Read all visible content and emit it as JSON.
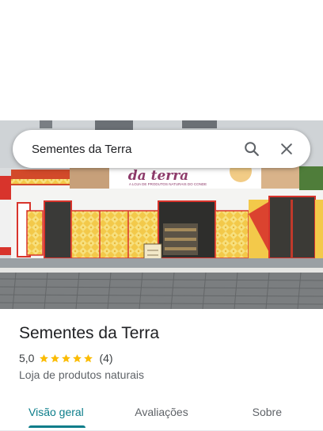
{
  "search": {
    "query": "Sementes da Terra",
    "search_icon": "search-icon",
    "close_icon": "close-icon"
  },
  "photo": {
    "sign_text": "da terra",
    "sign_subtext": "A LOJA DE PRODUTOS NATURAIS DO CONDE"
  },
  "place": {
    "name": "Sementes da Terra",
    "rating": "5,0",
    "stars": 5,
    "review_count": "(4)",
    "category": "Loja de produtos naturais"
  },
  "tabs": [
    {
      "label": "Visão geral",
      "active": true
    },
    {
      "label": "Avaliações",
      "active": false
    },
    {
      "label": "Sobre",
      "active": false
    }
  ],
  "colors": {
    "accent": "#0b7d8a",
    "star": "#fbbc04"
  }
}
